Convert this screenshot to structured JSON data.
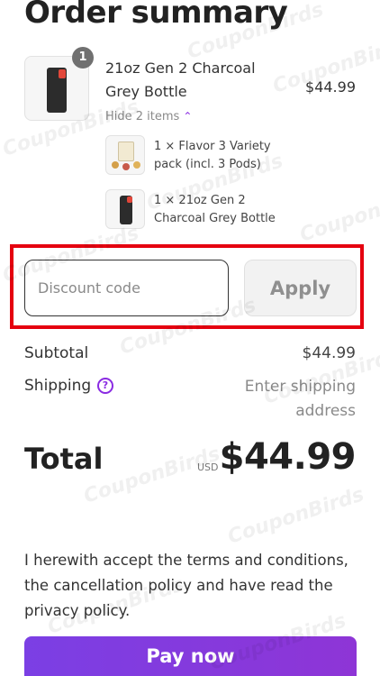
{
  "title": "Order summary",
  "main_item": {
    "name": "21oz Gen 2 Charcoal Grey Bottle",
    "quantity": "1",
    "price": "$44.99"
  },
  "toggle_items": "Hide 2 items",
  "bundle_items": [
    {
      "text": "1 × Flavor 3 Variety pack (incl. 3 Pods)"
    },
    {
      "text": "1 × 21oz Gen 2 Charcoal Grey Bottle"
    }
  ],
  "discount": {
    "placeholder": "Discount code",
    "apply_label": "Apply"
  },
  "summary": {
    "subtotal_label": "Subtotal",
    "subtotal_value": "$44.99",
    "shipping_label": "Shipping",
    "shipping_value": "Enter shipping address"
  },
  "total": {
    "label": "Total",
    "currency": "USD",
    "value": "$44.99"
  },
  "terms_text": "I herewith accept the terms and conditions, the cancellation policy and have read the privacy policy.",
  "pay_button_label": "Pay now",
  "watermark_text": "CouponBirds",
  "colors": {
    "accent": "#8a2be2",
    "pay_button": "#7b3fe4",
    "highlight_border": "#e5000f"
  }
}
